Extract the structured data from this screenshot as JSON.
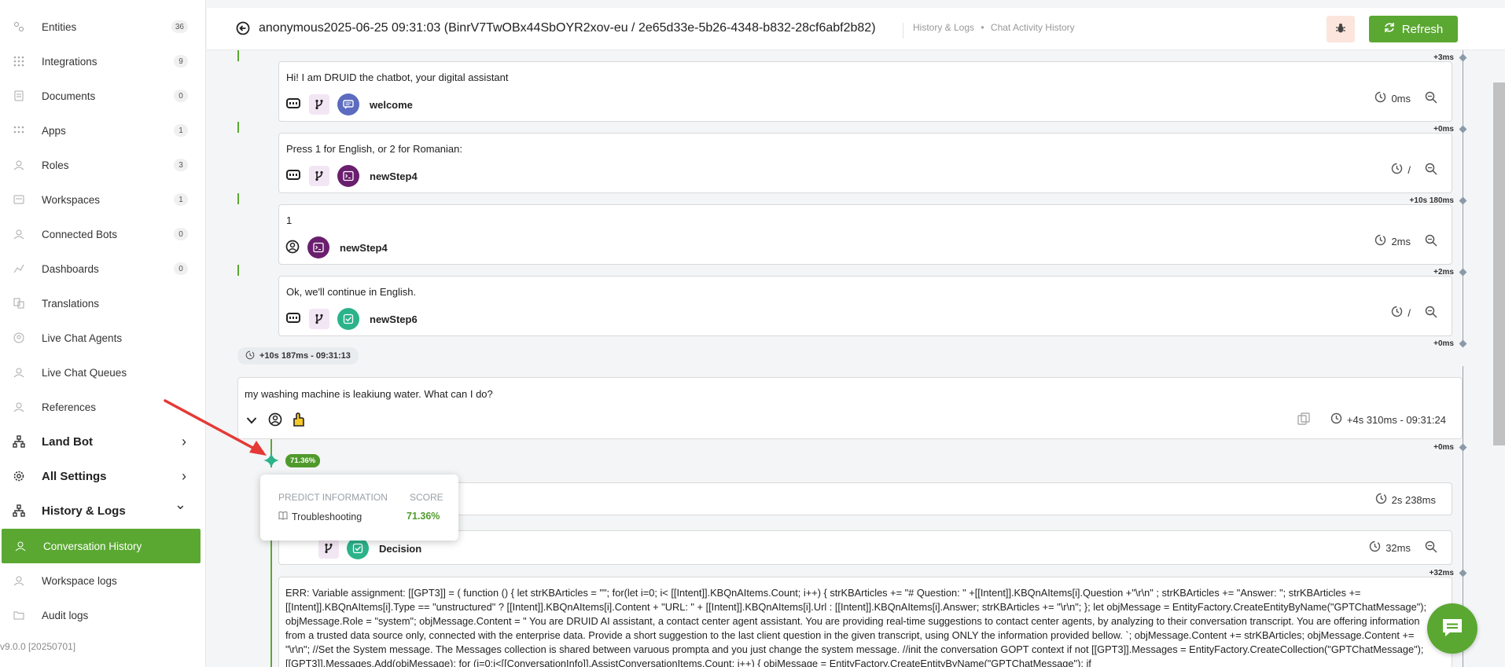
{
  "sidebar": {
    "items": [
      {
        "label": "Entities",
        "count": "36"
      },
      {
        "label": "Integrations",
        "count": "9"
      },
      {
        "label": "Documents",
        "count": "0"
      },
      {
        "label": "Apps",
        "count": "1"
      },
      {
        "label": "Roles",
        "count": "3"
      },
      {
        "label": "Workspaces",
        "count": "1"
      },
      {
        "label": "Connected Bots",
        "count": "0"
      },
      {
        "label": "Dashboards",
        "count": "0"
      },
      {
        "label": "Translations",
        "count": ""
      },
      {
        "label": "Live Chat Agents",
        "count": ""
      },
      {
        "label": "Live Chat Queues",
        "count": ""
      },
      {
        "label": "References",
        "count": ""
      }
    ],
    "groups": [
      {
        "label": "Land Bot",
        "chevron": "›"
      },
      {
        "label": "All Settings",
        "chevron": "›"
      },
      {
        "label": "History & Logs",
        "chevron": "⌄"
      }
    ],
    "sub_items": [
      {
        "label": "Conversation History"
      },
      {
        "label": "Workspace logs"
      },
      {
        "label": "Audit logs"
      }
    ],
    "version": "v9.0.0 [20250701]"
  },
  "header": {
    "title": "anonymous2025-06-25 09:31:03 (BinrV7TwOBx44SbOYR2xov-eu / 2e65d33e-5b26-4348-b832-28cf6abf2b82)",
    "breadcrumb_1": "History & Logs",
    "breadcrumb_sep": "•",
    "breadcrumb_2": "Chat Activity History",
    "refresh_label": "Refresh"
  },
  "timeline": {
    "cards": [
      {
        "message": "Hi! I am DRUID the chatbot, your digital assistant",
        "step": "welcome",
        "duration": "0ms"
      },
      {
        "message": "Press 1 for English, or 2 for Romanian:",
        "step": "newStep4",
        "duration": "/"
      },
      {
        "message": "1",
        "step": "newStep4",
        "duration": "2ms"
      },
      {
        "message": "Ok, we'll continue in English.",
        "step": "newStep6",
        "duration": "/"
      }
    ],
    "timings": [
      "+3ms",
      "+0ms",
      "+10s 180ms",
      "+2ms",
      "+0ms",
      "+0ms",
      "+32ms"
    ],
    "pill": "+10s 187ms - 09:31:13",
    "user_message": "my washing machine is leakiung water. What can I do?",
    "user_time": "+4s 310ms - 09:31:24",
    "score_badge": "71.36%",
    "hidden_card_duration": "2s 238ms",
    "decision_step": "Decision",
    "decision_duration": "32ms",
    "error_text": "ERR: Variable assignment: [[GPT3]] = ( function () { let strKBArticles = \"\"; for(let i=0; i< [[Intent]].KBQnAItems.Count; i++) { strKBArticles += \"# Question: \" +[[Intent]].KBQnAItems[i].Question +\"\\r\\n\" ; strKBArticles += \"Answer: \"; strKBArticles += [[Intent]].KBQnAItems[i].Type == \"unstructured\" ? [[Intent]].KBQnAItems[i].Content + \"URL: \" + [[Intent]].KBQnAItems[i].Url : [[Intent]].KBQnAItems[i].Answer; strKBArticles += \"\\r\\n\"; }; let objMessage = EntityFactory.CreateEntityByName(\"GPTChatMessage\"); objMessage.Role = \"system\"; objMessage.Content = \" You are DRUID AI assistant, a contact center agent assistant. You are providing real-time suggestions to contact center agents, by analyzing to their conversation transcript. You are offering information from a trusted data source only, connected with the enterprise data. Provide a short suggestion to the last client question in the given transcript, using ONLY the information provided bellow. `; objMessage.Content += strKBArticles; objMessage.Content += \"\\r\\n\"; //Set the System message. The Messages collection is shared between varuous prompta and you just change the system message. //init the conversation GOPT context if not [[GPT3]].Messages = EntityFactory.CreateCollection(\"GPTChatMessage\"); [[GPT3]].Messages.Add(objMessage); for (i=0;i<[[ConversationInfo]].AssistConversationItems.Count; i++) { objMessage = EntityFactory.CreateEntityByName(\"GPTChatMessage\"); if"
  },
  "popover": {
    "header_info": "PREDICT INFORMATION",
    "header_score": "SCORE",
    "row_label": "Troubleshooting",
    "row_score": "71.36%"
  },
  "colors": {
    "accent": "#5aa832",
    "purple": "#6a1f6e",
    "indigo": "#5c6bc0",
    "teal": "#2bb389"
  }
}
